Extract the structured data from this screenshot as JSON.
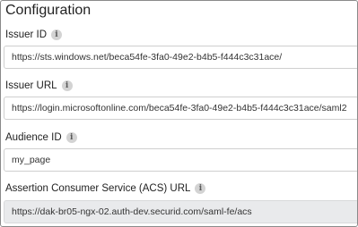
{
  "section": {
    "title": "Configuration"
  },
  "fields": [
    {
      "label": "Issuer ID",
      "value": "https://sts.windows.net/beca54fe-3fa0-49e2-b4b5-f444c3c31ace/",
      "info_icon": "info-icon"
    },
    {
      "label": "Issuer URL",
      "value": "https://login.microsoftonline.com/beca54fe-3fa0-49e2-b4b5-f444c3c31ace/saml2",
      "info_icon": "info-icon"
    },
    {
      "label": "Audience ID",
      "value": "my_page",
      "info_icon": "info-icon"
    },
    {
      "label": "Assertion Consumer Service (ACS) URL",
      "value": "https://dak-br05-ngx-02.auth-dev.securid.com/saml-fe/acs",
      "info_icon": "info-icon",
      "readonly": true
    }
  ],
  "info_glyph": "i"
}
